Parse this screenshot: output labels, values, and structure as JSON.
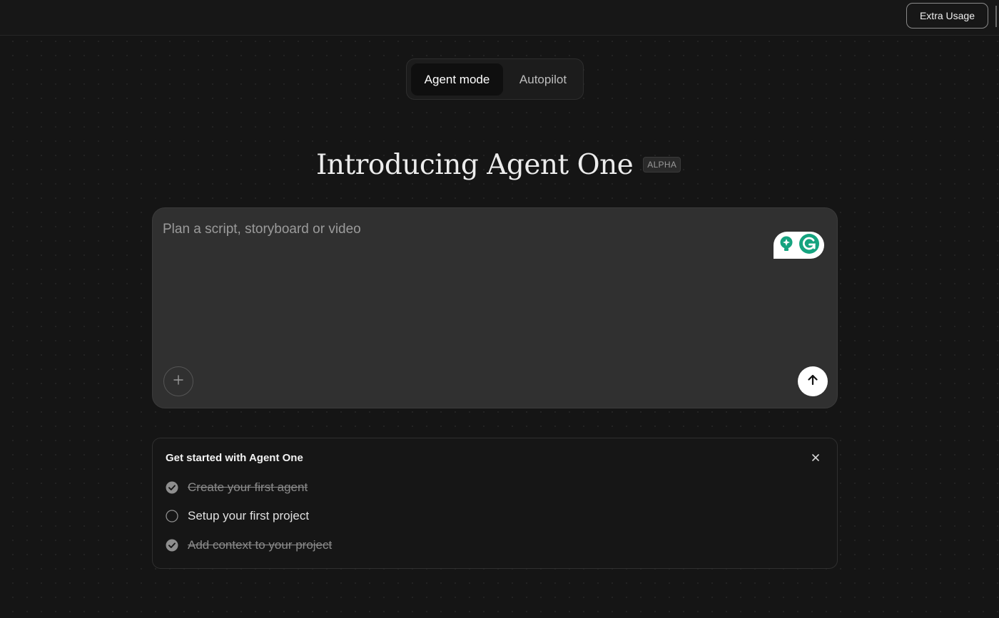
{
  "topbar": {
    "extra_usage_label": "Extra Usage"
  },
  "mode_toggle": {
    "active": "Agent mode",
    "tabs": [
      {
        "label": "Agent mode"
      },
      {
        "label": "Autopilot"
      }
    ]
  },
  "hero": {
    "title": "Introducing Agent One",
    "badge": "ALPHA"
  },
  "prompt": {
    "placeholder": "Plan a script, storyboard or video",
    "value": "",
    "add_icon": "plus-icon",
    "send_icon": "arrow-up-icon",
    "extension_icons": [
      "lightbulb-icon",
      "grammarly-icon"
    ]
  },
  "getting_started": {
    "title": "Get started with Agent One",
    "close_icon": "close-icon",
    "tasks": [
      {
        "label": "Create your first agent",
        "done": true
      },
      {
        "label": "Setup your first project",
        "done": false
      },
      {
        "label": "Add context to your project",
        "done": true
      }
    ]
  },
  "colors": {
    "background": "#151515",
    "panel": "#303030",
    "grammarly_green": "#15a37f",
    "send_button": "#ffffff"
  }
}
